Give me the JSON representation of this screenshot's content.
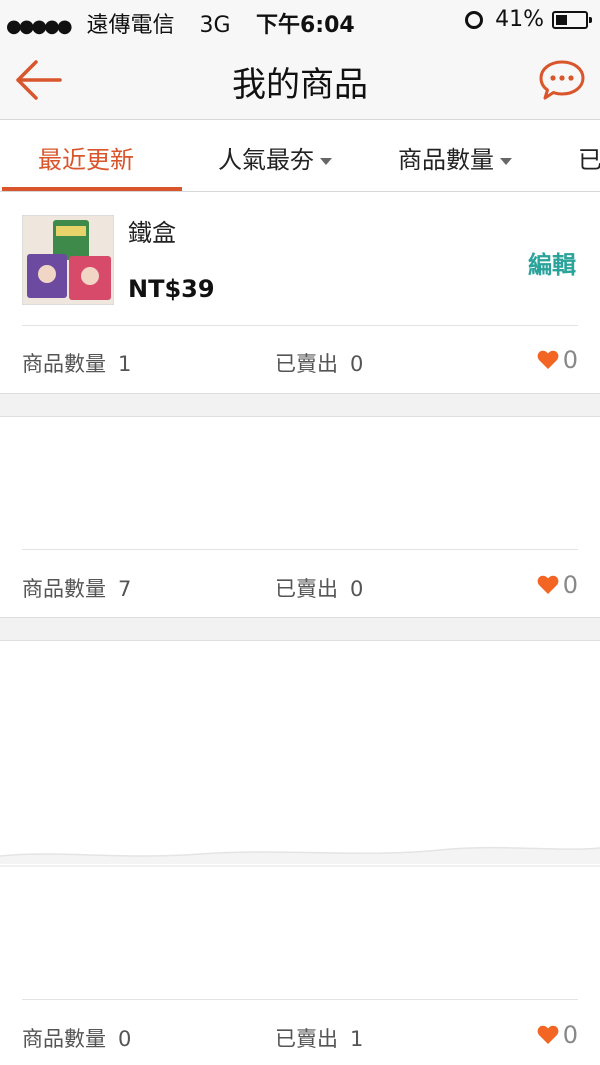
{
  "status_bar": {
    "signal": "●●●●●",
    "carrier": "遠傳電信",
    "network": "3G",
    "time": "下午6:04",
    "battery_text": "41%",
    "battery_level": 0.41
  },
  "nav": {
    "title": "我的商品"
  },
  "tabs": [
    {
      "label": "最近更新",
      "active": true
    },
    {
      "label": "人氣最夯"
    },
    {
      "label": "商品數量"
    },
    {
      "label": "已"
    }
  ],
  "products": [
    {
      "name": "鐵盒",
      "price": "NT$39",
      "edit_label": "編輯",
      "quantity_label": "商品數量",
      "quantity": "1",
      "sold_label": "已賣出",
      "sold": "0",
      "likes": "0"
    },
    {
      "quantity_label": "商品數量",
      "quantity": "7",
      "sold_label": "已賣出",
      "sold": "0",
      "likes": "0"
    },
    {
      "quantity_label": "商品數量",
      "quantity": "0",
      "sold_label": "已賣出",
      "sold": "1",
      "likes": "0"
    }
  ],
  "colors": {
    "accent": "#d9552b",
    "edit": "#2aa39a",
    "heart": "#f26522"
  },
  "icons": {
    "back": "back-arrow-icon",
    "chat": "chat-bubble-icon",
    "alarm": "alarm-clock-icon",
    "battery": "battery-icon",
    "heart": "heart-icon",
    "caret": "caret-down-icon"
  }
}
